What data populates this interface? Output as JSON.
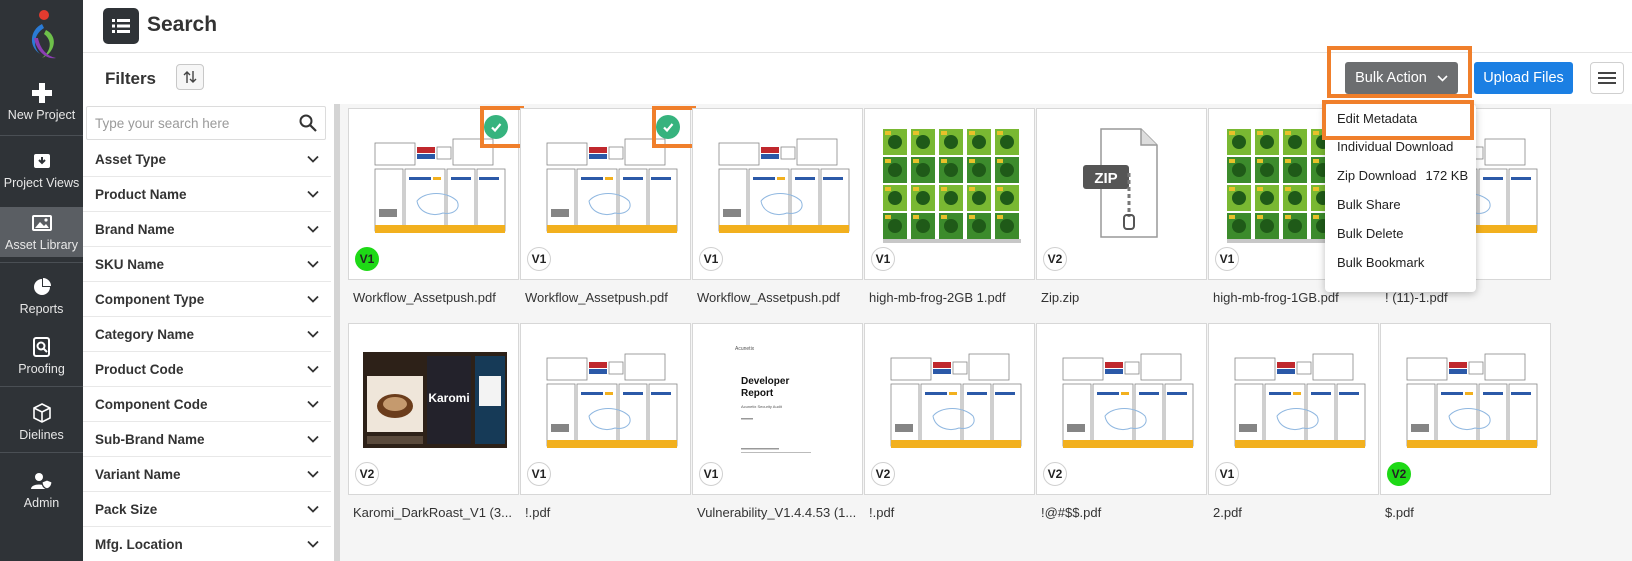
{
  "nav": {
    "items": [
      {
        "label": "New Project",
        "icon": "plus-icon"
      },
      {
        "label": "Project Views",
        "icon": "inbox-download-icon"
      },
      {
        "label": "Asset Library",
        "icon": "image-icon"
      },
      {
        "label": "Reports",
        "icon": "pie-chart-icon"
      },
      {
        "label": "Proofing",
        "icon": "proof-search-icon"
      },
      {
        "label": "Dielines",
        "icon": "cube-icon"
      },
      {
        "label": "Admin",
        "icon": "user-shield-icon"
      }
    ],
    "active": "Asset Library"
  },
  "header": {
    "title": "Search"
  },
  "toolbar": {
    "filters_title": "Filters",
    "bulk_action_label": "Bulk Action",
    "upload_label": "Upload Files"
  },
  "filters": {
    "search_placeholder": "Type your search here",
    "items": [
      "Asset Type",
      "Product Name",
      "Brand Name",
      "SKU Name",
      "Component Type",
      "Category Name",
      "Product Code",
      "Component Code",
      "Sub-Brand Name",
      "Variant Name",
      "Pack Size",
      "Mfg. Location"
    ]
  },
  "bulk_menu": {
    "items": [
      {
        "label": "Edit Metadata"
      },
      {
        "label": "Individual Download"
      },
      {
        "label": "Zip Download",
        "size": "172 KB"
      },
      {
        "label": "Bulk Share"
      },
      {
        "label": "Bulk Delete"
      },
      {
        "label": "Bulk Bookmark"
      }
    ]
  },
  "assets": [
    {
      "name": "Workflow_Assetpush.pdf",
      "version": "V1",
      "thumb": "dieline",
      "selected": true,
      "green": true
    },
    {
      "name": "Workflow_Assetpush.pdf",
      "version": "V1",
      "thumb": "dieline",
      "selected": true,
      "green": false
    },
    {
      "name": "Workflow_Assetpush.pdf",
      "version": "V1",
      "thumb": "dieline",
      "selected": false,
      "green": false
    },
    {
      "name": "high-mb-frog-2GB 1.pdf",
      "version": "V1",
      "thumb": "frog",
      "selected": false,
      "green": false
    },
    {
      "name": "Zip.zip",
      "version": "V2",
      "thumb": "zip",
      "selected": false,
      "green": false
    },
    {
      "name": "high-mb-frog-1GB.pdf",
      "version": "V1",
      "thumb": "frog",
      "selected": false,
      "green": false
    },
    {
      "name": "! (11)-1.pdf",
      "version": "",
      "thumb": "dieline",
      "selected": false,
      "green": false
    },
    {
      "name": "Karomi_DarkRoast_V1 (3...",
      "version": "V2",
      "thumb": "coffee",
      "selected": false,
      "green": false
    },
    {
      "name": "!.pdf",
      "version": "V1",
      "thumb": "dieline",
      "selected": false,
      "green": false
    },
    {
      "name": "Vulnerability_V1.4.4.53 (1...",
      "version": "V1",
      "thumb": "report",
      "selected": false,
      "green": false
    },
    {
      "name": "!.pdf",
      "version": "V2",
      "thumb": "dieline",
      "selected": false,
      "green": false
    },
    {
      "name": "!@#$$.pdf",
      "version": "V2",
      "thumb": "dieline",
      "selected": false,
      "green": false
    },
    {
      "name": "2.pdf",
      "version": "V1",
      "thumb": "dieline",
      "selected": false,
      "green": false
    },
    {
      "name": "$.pdf",
      "version": "V2",
      "thumb": "dieline",
      "selected": false,
      "green": true
    }
  ],
  "thumb_text": {
    "zip": "ZIP",
    "report_logo": "Acunetix",
    "report_title_1": "Developer",
    "report_title_2": "Report",
    "report_sub": "Acunetix Security Audit",
    "coffee_brand": "Karomi"
  },
  "colors": {
    "sidebar_bg": "#2f3337",
    "highlight": "#f07f2b",
    "upload_blue": "#1b7fe3",
    "bulk_gray": "#6c6e70",
    "check_green": "#36b37e",
    "version_green": "#1ed916"
  }
}
